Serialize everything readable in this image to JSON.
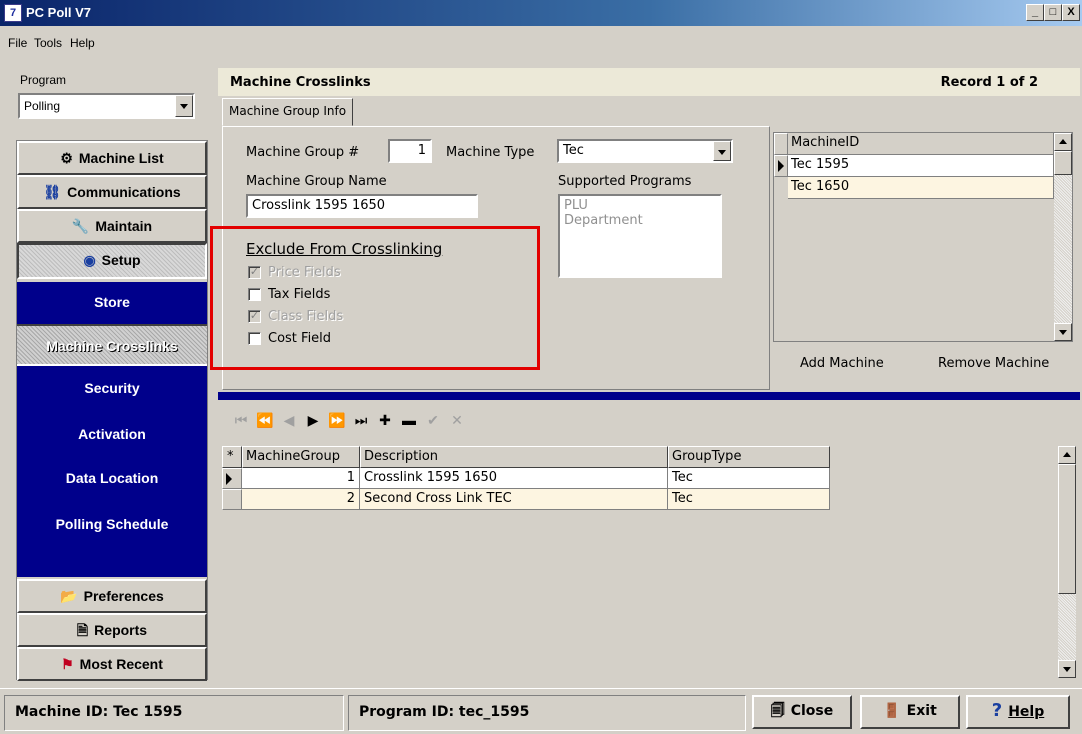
{
  "window": {
    "title": "PC Poll V7",
    "app_icon": "7",
    "controls": {
      "minimize": "_",
      "maximize": "□",
      "close": "X"
    }
  },
  "menu": [
    {
      "label": "File"
    },
    {
      "label": "Tools"
    },
    {
      "label": "Help"
    }
  ],
  "sidebar": {
    "program_label": "Program",
    "program_value": "Polling",
    "nav_top": [
      {
        "label": "Machine List",
        "icon": "gear-icon",
        "glyph": "⚙"
      },
      {
        "label": "Communications",
        "icon": "network-icon",
        "glyph": "⛓"
      },
      {
        "label": "Maintain",
        "icon": "wrench-icon",
        "glyph": "🔧"
      },
      {
        "label": "Setup",
        "icon": "setup-globe-icon",
        "glyph": "◉"
      }
    ],
    "sub_items": [
      {
        "label": "Store"
      },
      {
        "label": "Machine Crosslinks"
      },
      {
        "label": "Security"
      },
      {
        "label": "Activation"
      },
      {
        "label": "Data Location"
      },
      {
        "label": "Polling Schedule"
      }
    ],
    "nav_bottom": [
      {
        "label": "Preferences",
        "icon": "folder-icon",
        "glyph": "📂"
      },
      {
        "label": "Reports",
        "icon": "report-icon",
        "glyph": "🗎"
      },
      {
        "label": "Most Recent",
        "icon": "flag-icon",
        "glyph": "⚑"
      }
    ]
  },
  "main": {
    "title": "Machine Crosslinks",
    "record_info": "Record  1  of  2",
    "tab_label": "Machine Group Info",
    "form": {
      "group_num_label": "Machine Group #",
      "group_num_value": "1",
      "machine_type_label": "Machine Type",
      "machine_type_value": "Tec",
      "group_name_label": "Machine Group Name",
      "group_name_value": "Crosslink 1595 1650",
      "supported_programs_label": "Supported Programs",
      "supported_programs": [
        "PLU",
        "Department"
      ],
      "exclude_heading": "Exclude From Crosslinking",
      "checkboxes": [
        {
          "label": "Price Fields",
          "checked": true,
          "enabled": false
        },
        {
          "label": "Tax Fields",
          "checked": false,
          "enabled": true
        },
        {
          "label": "Class Fields",
          "checked": true,
          "enabled": false
        },
        {
          "label": "Cost Field",
          "checked": false,
          "enabled": true
        }
      ]
    },
    "machine_grid": {
      "header": "MachineID",
      "rows": [
        "Tec 1595",
        "Tec 1650"
      ],
      "add_label": "Add Machine",
      "remove_label": "Remove Machine"
    },
    "toolbar_glyphs": [
      "⏮",
      "⏪",
      "◀",
      "▶",
      "⏩",
      "⏭",
      "✚",
      "▬",
      "✔",
      "✕"
    ],
    "groups_grid": {
      "header_marker": "*",
      "columns": [
        "MachineGroup",
        "Description",
        "GroupType"
      ],
      "rows": [
        {
          "num": "1",
          "desc": "Crosslink 1595 1650",
          "type": "Tec"
        },
        {
          "num": "2",
          "desc": "Second Cross Link TEC",
          "type": "Tec"
        }
      ]
    }
  },
  "status": {
    "machine_id": "Machine ID: Tec 1595",
    "program_id": "Program ID: tec_1595",
    "close_label": "Close",
    "exit_label": "Exit",
    "help_label": "Help",
    "close_glyph": "🗐",
    "exit_glyph": "🚪",
    "help_glyph": "?"
  },
  "colors": {
    "nav_blue": "#00008b",
    "highlight_red": "#e30000",
    "row_alt": "#fdf5e1"
  }
}
